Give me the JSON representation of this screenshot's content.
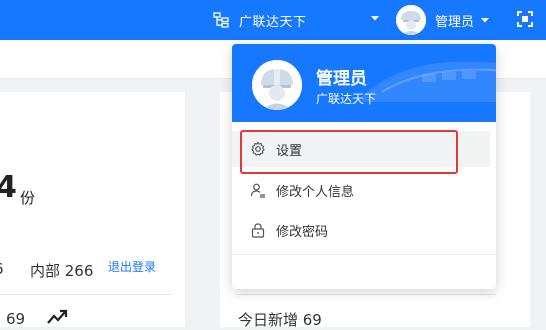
{
  "header": {
    "org_name": "广联达天下",
    "username": "管理员"
  },
  "background": {
    "big_number_partial": "4",
    "big_unit": "份",
    "stat_left_partial": "6",
    "stat_internal": "内部 266",
    "stat_69": "69",
    "today_new": "今日新增 69"
  },
  "dropdown": {
    "name": "管理员",
    "org": "广联达天下",
    "items": [
      {
        "label": "设置",
        "icon": "gear-icon"
      },
      {
        "label": "修改个人信息",
        "icon": "user-edit-icon"
      },
      {
        "label": "修改密码",
        "icon": "lock-icon"
      }
    ],
    "logout": "退出登录"
  },
  "colors": {
    "primary": "#1677ff",
    "highlight": "#e53935"
  }
}
